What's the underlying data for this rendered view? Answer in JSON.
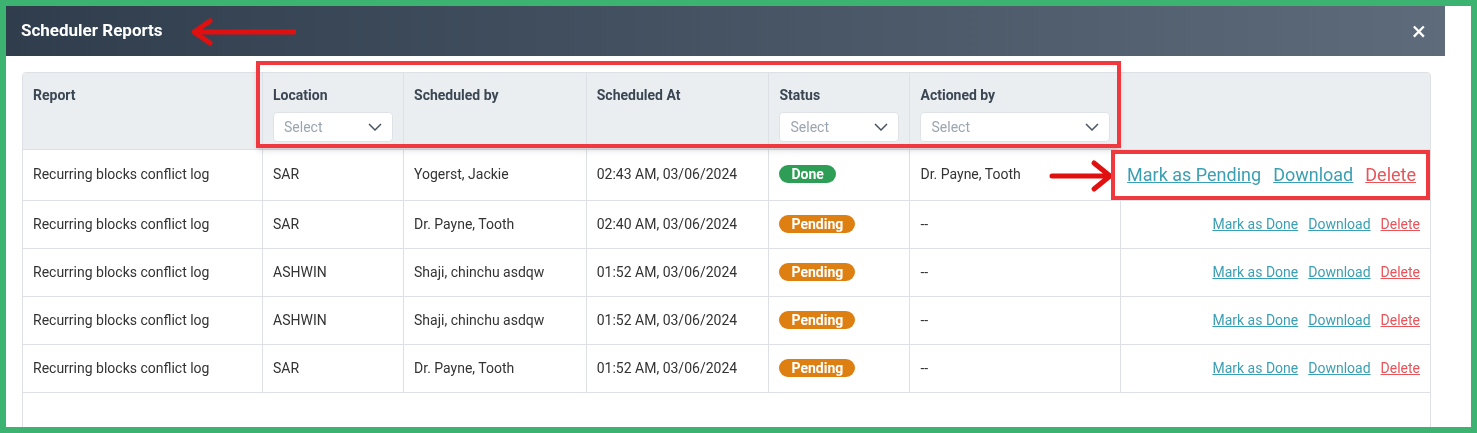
{
  "dialog": {
    "title": "Scheduler Reports",
    "close": "×"
  },
  "table": {
    "columns": [
      {
        "label": "Report"
      },
      {
        "label": "Location",
        "filter": "Select"
      },
      {
        "label": "Scheduled by"
      },
      {
        "label": "Scheduled At"
      },
      {
        "label": "Status",
        "filter": "Select"
      },
      {
        "label": "Actioned by",
        "filter": "Select"
      }
    ],
    "rows": [
      {
        "report": "Recurring blocks conflict log",
        "location": "SAR",
        "scheduled_by": "Yogerst, Jackie",
        "scheduled_at": "02:43 AM, 03/06/2024",
        "status": {
          "label": "Done",
          "kind": "done"
        },
        "actioned_by": "Dr. Payne, Tooth",
        "highlighted": true,
        "actions": [
          {
            "label": "Mark as Pending",
            "kind": "link"
          },
          {
            "label": "Download",
            "kind": "link"
          },
          {
            "label": "Delete",
            "kind": "danger"
          }
        ]
      },
      {
        "report": "Recurring blocks conflict log",
        "location": "SAR",
        "scheduled_by": "Dr. Payne, Tooth",
        "scheduled_at": "02:40 AM, 03/06/2024",
        "status": {
          "label": "Pending",
          "kind": "pending"
        },
        "actioned_by": "--",
        "highlighted": false,
        "actions": [
          {
            "label": "Mark as Done",
            "kind": "link"
          },
          {
            "label": "Download",
            "kind": "link"
          },
          {
            "label": "Delete",
            "kind": "danger"
          }
        ]
      },
      {
        "report": "Recurring blocks conflict log",
        "location": "ASHWIN",
        "scheduled_by": "Shaji, chinchu asdqw",
        "scheduled_at": "01:52 AM, 03/06/2024",
        "status": {
          "label": "Pending",
          "kind": "pending"
        },
        "actioned_by": "--",
        "highlighted": false,
        "actions": [
          {
            "label": "Mark as Done",
            "kind": "link"
          },
          {
            "label": "Download",
            "kind": "link"
          },
          {
            "label": "Delete",
            "kind": "danger"
          }
        ]
      },
      {
        "report": "Recurring blocks conflict log",
        "location": "ASHWIN",
        "scheduled_by": "Shaji, chinchu asdqw",
        "scheduled_at": "01:52 AM, 03/06/2024",
        "status": {
          "label": "Pending",
          "kind": "pending"
        },
        "actioned_by": "--",
        "highlighted": false,
        "actions": [
          {
            "label": "Mark as Done",
            "kind": "link"
          },
          {
            "label": "Download",
            "kind": "link"
          },
          {
            "label": "Delete",
            "kind": "danger"
          }
        ]
      },
      {
        "report": "Recurring blocks conflict log",
        "location": "SAR",
        "scheduled_by": "Dr. Payne, Tooth",
        "scheduled_at": "01:52 AM, 03/06/2024",
        "status": {
          "label": "Pending",
          "kind": "pending"
        },
        "actioned_by": "--",
        "highlighted": false,
        "actions": [
          {
            "label": "Mark as Done",
            "kind": "link"
          },
          {
            "label": "Download",
            "kind": "link"
          },
          {
            "label": "Delete",
            "kind": "danger"
          }
        ]
      }
    ]
  }
}
